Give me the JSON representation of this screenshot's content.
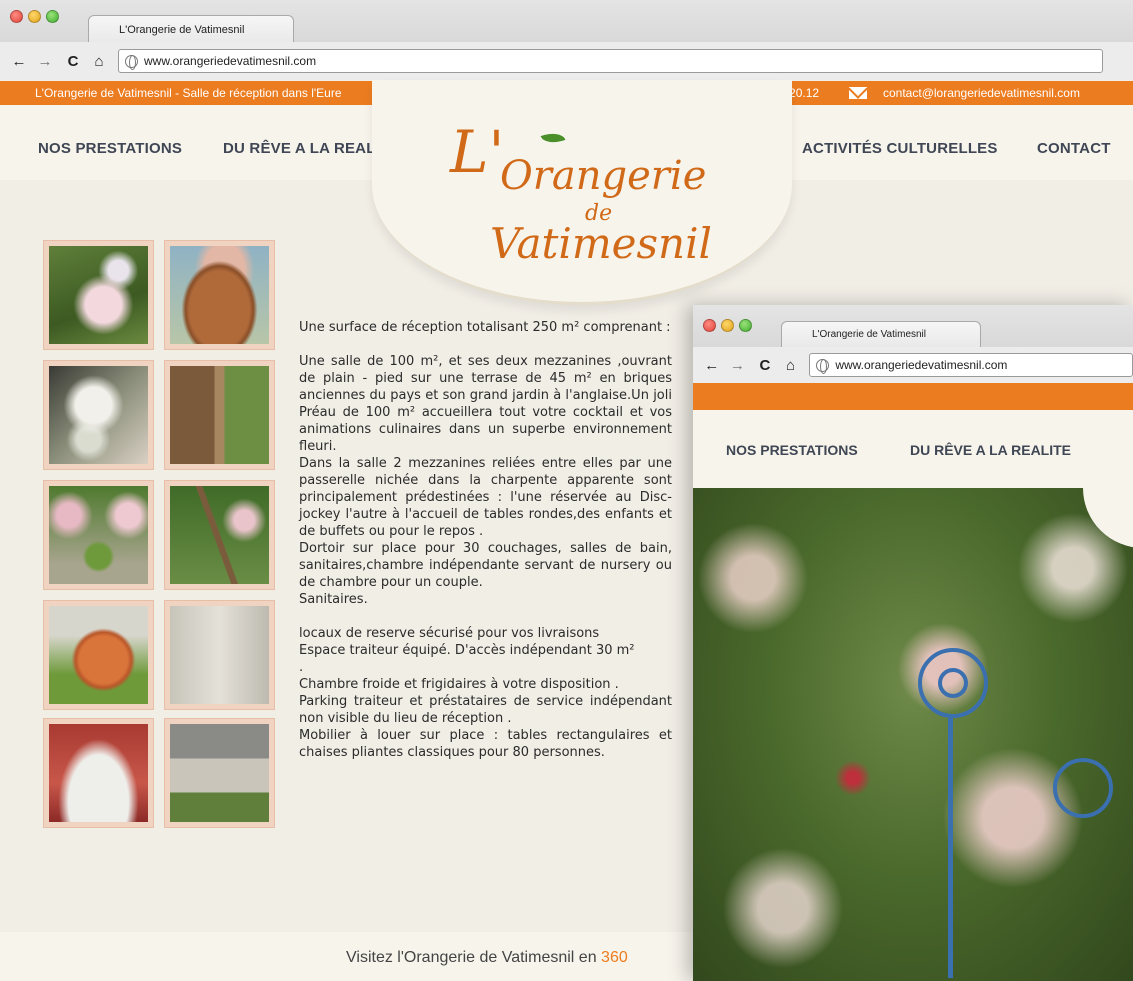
{
  "browser": {
    "tab_title": "L'Orangerie de Vatimesnil",
    "url": "www.orangeriedevatimesnil.com",
    "back_icon": "←",
    "forward_icon": "→",
    "reload_icon": "C",
    "home_icon": "⌂"
  },
  "topbar": {
    "tagline": "L'Orangerie de Vatimesnil - Salle de réception dans l'Eure",
    "phone": "06.65.22.20.12",
    "email": "contact@lorangeriedevatimesnil.com"
  },
  "nav": {
    "prestations": "NOS PRESTATIONS",
    "reve": "DU RÊVE A LA REALITE",
    "activites": "ACTIVITÉS CULTURELLES",
    "contact": "CONTACT"
  },
  "logo": {
    "line1": "L'",
    "line2": "Orangerie",
    "line3": "de",
    "line4": "Vatimesnil"
  },
  "content": {
    "p1": "Une surface de réception totalisant 250 m² comprenant :",
    "p2": "Une salle de 100 m², et ses deux mezzanines ,ouvrant de plain - pied sur une terrase de 45 m² en briques anciennes du pays et son grand jardin à l'anglaise.Un joli Préau de 100 m² accueillera tout votre cocktail et vos animations culinaires dans un superbe environnement fleuri.",
    "p3": "Dans la salle 2 mezzanines reliées entre elles par une passerelle nichée dans la charpente apparente sont principalement prédestinées : l'une réservée au Disc-jockey l'autre à l'accueil de tables rondes,des enfants et de buffets ou pour le repos .",
    "p4": "Dortoir sur place pour 30 couchages, salles de bain, sanitaires,chambre indépendante servant de nursery ou de chambre pour un couple.",
    "p5": "Sanitaires.",
    "p6": "locaux de reserve sécurisé pour vos livraisons",
    "p7": "Espace traiteur équipé. D'accès indépendant 30 m²",
    "p8": ".",
    "p9": "Chambre froide et frigidaires à votre disposition .",
    "p10": "Parking traiteur et préstataires de service indépendant non visible du lieu de réception .",
    "p11": "Mobilier à louer sur place : tables rectangulaires et chaises pliantes classiques pour 80 personnes."
  },
  "footer": {
    "text": "Visitez l'Orangerie de Vatimesnil en",
    "highlight": "360"
  },
  "colors": {
    "accent": "#ec7c20",
    "nav_text": "#3f4654",
    "background": "#f1eee6"
  }
}
